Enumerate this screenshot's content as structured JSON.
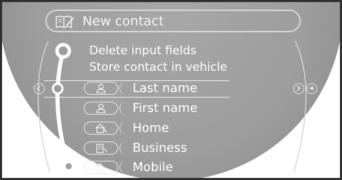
{
  "header": {
    "title": "New contact",
    "icon": "notebook-pen-icon"
  },
  "menu": {
    "items": [
      {
        "label": "Delete input fields"
      },
      {
        "label": "Store contact in vehicle"
      }
    ]
  },
  "fields": [
    {
      "label": "Last name",
      "icon": "person-icon",
      "selected": true
    },
    {
      "label": "First name",
      "icon": "person-icon",
      "selected": false
    },
    {
      "label": "Home",
      "icon": "house-phone-icon",
      "selected": false
    },
    {
      "label": "Business",
      "icon": "office-phone-icon",
      "selected": false
    },
    {
      "label": "Mobile",
      "icon": "mobile-phone-icon",
      "selected": false
    }
  ],
  "navigation": {
    "left": "arrow-left-icon",
    "right": "arrow-right-icon",
    "right_extra": "arrow-right-skip-icon"
  },
  "colors": {
    "background": "#9d9d9d",
    "text": "#ffffff",
    "frame": "#2e2e2e"
  }
}
